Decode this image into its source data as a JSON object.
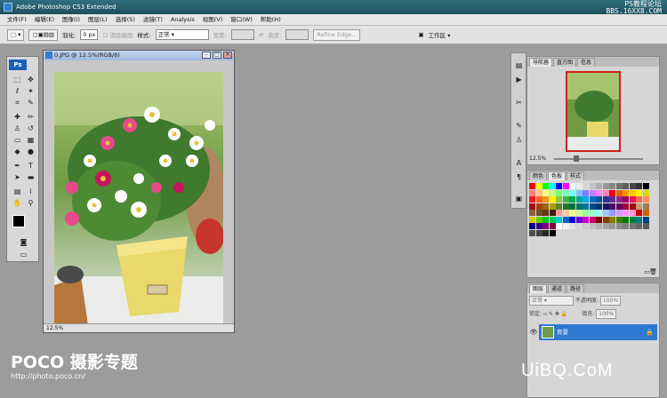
{
  "app": {
    "title": "Adobe Photoshop CS3 Extended",
    "watermark_line1": "PS教程论坛",
    "watermark_line2": "BBS.16XX8.COM"
  },
  "menu": [
    "文件(F)",
    "编辑(E)",
    "图像(I)",
    "图层(L)",
    "选择(S)",
    "滤镜(T)",
    "Analysis",
    "视图(V)",
    "窗口(W)",
    "帮助(H)"
  ],
  "options": {
    "feather_label": "羽化:",
    "feather_value": "0 px",
    "antialias_label": "消除锯齿",
    "style_label": "样式:",
    "style_value": "正常",
    "width_label": "宽度:",
    "height_label": "高度:",
    "refine_edge": "Refine Edge...",
    "workspace": "工作区 ▾"
  },
  "toolbox": {
    "logo": "Ps",
    "tools": [
      "marquee-tool",
      "move-tool",
      "lasso-tool",
      "magic-wand-tool",
      "crop-tool",
      "slice-tool",
      "healing-brush-tool",
      "brush-tool",
      "clone-stamp-tool",
      "history-brush-tool",
      "eraser-tool",
      "gradient-tool",
      "blur-tool",
      "dodge-tool",
      "pen-tool",
      "type-tool",
      "path-selection-tool",
      "shape-tool",
      "notes-tool",
      "eyedropper-tool",
      "hand-tool",
      "zoom-tool"
    ]
  },
  "document": {
    "title": "0.JPG @ 12.5%(RGB/8)",
    "zoom": "12.5%"
  },
  "navigator": {
    "tabs": [
      "导航器",
      "直方图",
      "信息"
    ],
    "zoom": "12.5%"
  },
  "swatches": {
    "tabs": [
      "颜色",
      "色板",
      "样式"
    ],
    "colors": [
      "#ff0000",
      "#ffff00",
      "#00ff00",
      "#00ffff",
      "#0000ff",
      "#ff00ff",
      "#ffffff",
      "#ebebeb",
      "#d6d6d6",
      "#c2c2c2",
      "#adadad",
      "#999999",
      "#858585",
      "#707070",
      "#5c5c5c",
      "#474747",
      "#333333",
      "#000000",
      "#ff7f7f",
      "#ffbf7f",
      "#ffff7f",
      "#bfff7f",
      "#7fff7f",
      "#7fffbf",
      "#7fffff",
      "#7fbfff",
      "#7f7fff",
      "#bf7fff",
      "#ff7fff",
      "#ff7fbf",
      "#e60012",
      "#eb6100",
      "#f39800",
      "#fcc800",
      "#fff100",
      "#cfdb00",
      "#ed1c24",
      "#f26522",
      "#f7941d",
      "#fff200",
      "#8dc63f",
      "#39b54a",
      "#00a651",
      "#00a99d",
      "#00aeef",
      "#0072bc",
      "#0054a6",
      "#2e3192",
      "#662d91",
      "#92278f",
      "#9e005d",
      "#ed145b",
      "#f26c4f",
      "#f68e56",
      "#9e0b0f",
      "#a0410d",
      "#a3620a",
      "#aba000",
      "#598527",
      "#197b30",
      "#007236",
      "#00746b",
      "#0076a3",
      "#004b80",
      "#003471",
      "#1b1464",
      "#440e62",
      "#630460",
      "#9e0039",
      "#9e0b0f",
      "#c69c6d",
      "#a67c52",
      "#8c6239",
      "#754c24",
      "#603913",
      "#3c2415",
      "#ff9999",
      "#ffcc99",
      "#ffff99",
      "#ccff99",
      "#99ff99",
      "#99ffcc",
      "#99ffff",
      "#99ccff",
      "#9999ff",
      "#cc99ff",
      "#ff99ff",
      "#ff99cc",
      "#cc0000",
      "#cc6600",
      "#cccc00",
      "#66cc00",
      "#00cc00",
      "#00cc66",
      "#00cccc",
      "#0066cc",
      "#0000cc",
      "#6600cc",
      "#cc00cc",
      "#cc0066",
      "#800000",
      "#804000",
      "#808000",
      "#408000",
      "#008000",
      "#008040",
      "#008080",
      "#004080",
      "#000080",
      "#400080",
      "#800080",
      "#800040",
      "#ffffff",
      "#f2f2f2",
      "#e6e6e6",
      "#d9d9d9",
      "#cccccc",
      "#bfbfbf",
      "#b3b3b3",
      "#a6a6a6",
      "#999999",
      "#8c8c8c",
      "#808080",
      "#737373",
      "#666666",
      "#595959",
      "#4d4d4d",
      "#404040",
      "#262626",
      "#000000"
    ]
  },
  "layers": {
    "tabs": [
      "图层",
      "通道",
      "路径"
    ],
    "blend_mode": "正常",
    "opacity_label": "不透明度:",
    "opacity_value": "100%",
    "lock_label": "锁定:",
    "fill_label": "填充:",
    "fill_value": "100%",
    "layer_name": "背景"
  },
  "footer": {
    "poco_logo": "POCO 摄影专题",
    "poco_url": "http://photo.poco.cn/",
    "site_logo": "UiBQ.CoM"
  }
}
